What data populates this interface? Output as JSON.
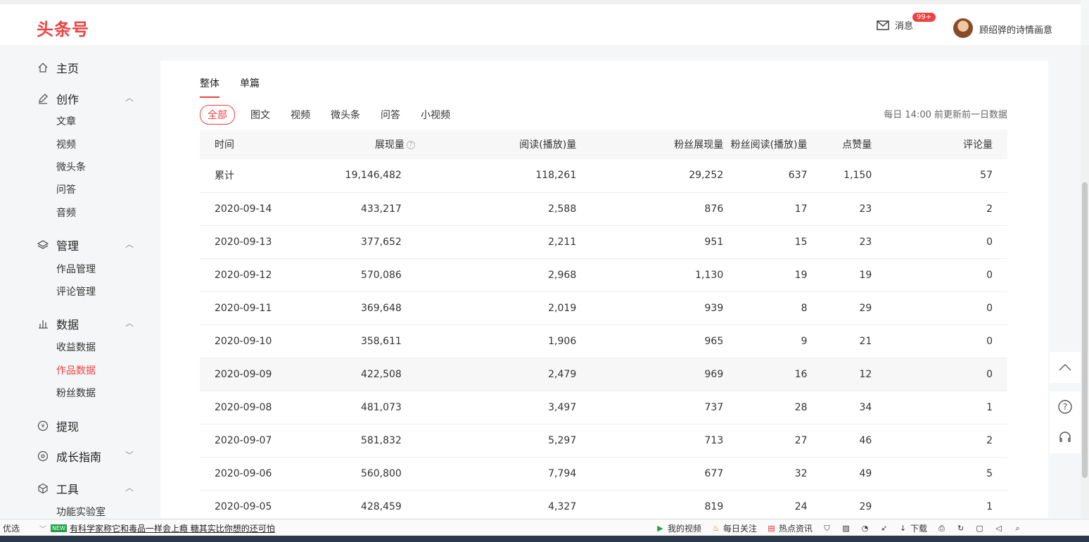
{
  "header": {
    "logo": "头条号",
    "messages_label": "消息",
    "messages_badge": "99+",
    "username": "顾绍骅的诗情画意"
  },
  "sidebar": {
    "groups": [
      {
        "label": "主页",
        "icon": "home-icon"
      },
      {
        "label": "创作",
        "icon": "pen-icon",
        "items": [
          "文章",
          "视频",
          "微头条",
          "问答",
          "音频"
        ]
      },
      {
        "label": "管理",
        "icon": "layers-icon",
        "items": [
          "作品管理",
          "评论管理"
        ]
      },
      {
        "label": "数据",
        "icon": "bar-chart-icon",
        "items": [
          "收益数据",
          "作品数据",
          "粉丝数据"
        ]
      },
      {
        "label": "提现",
        "icon": "coin-icon"
      },
      {
        "label": "成长指南",
        "icon": "compass-icon"
      },
      {
        "label": "工具",
        "icon": "cube-icon",
        "items": [
          "功能实验室"
        ]
      }
    ],
    "active_item": "作品数据"
  },
  "main": {
    "tabs_primary": [
      "整体",
      "单篇"
    ],
    "tabs_secondary": [
      "全部",
      "图文",
      "视频",
      "微头条",
      "问答",
      "小视频"
    ],
    "update_note": "每日 14:00 前更新前一日数据",
    "table": {
      "headers": [
        "时间",
        "展现量",
        "阅读(播放)量",
        "粉丝展现量",
        "粉丝阅读(播放)量",
        "点赞量",
        "评论量"
      ],
      "rows": [
        [
          "累计",
          "19,146,482",
          "118,261",
          "29,252",
          "637",
          "1,150",
          "57"
        ],
        [
          "2020-09-14",
          "433,217",
          "2,588",
          "876",
          "17",
          "23",
          "2"
        ],
        [
          "2020-09-13",
          "377,652",
          "2,211",
          "951",
          "15",
          "23",
          "0"
        ],
        [
          "2020-09-12",
          "570,086",
          "2,968",
          "1,130",
          "19",
          "19",
          "0"
        ],
        [
          "2020-09-11",
          "369,648",
          "2,019",
          "939",
          "8",
          "29",
          "0"
        ],
        [
          "2020-09-10",
          "358,611",
          "1,906",
          "965",
          "9",
          "21",
          "0"
        ],
        [
          "2020-09-09",
          "422,508",
          "2,479",
          "969",
          "16",
          "12",
          "0"
        ],
        [
          "2020-09-08",
          "481,073",
          "3,497",
          "737",
          "28",
          "34",
          "1"
        ],
        [
          "2020-09-07",
          "581,832",
          "5,297",
          "713",
          "27",
          "46",
          "2"
        ],
        [
          "2020-09-06",
          "560,800",
          "7,794",
          "677",
          "32",
          "49",
          "5"
        ],
        [
          "2020-09-05",
          "428,459",
          "4,327",
          "819",
          "24",
          "29",
          "1"
        ]
      ]
    }
  },
  "statusbar": {
    "left_label": "优选",
    "new_tag": "NEW",
    "news": "有科学家称它和毒品一样会上瘾 糖其实比你想的还可怕",
    "items": [
      "我的视频",
      "每日关注",
      "热点资讯",
      "下载"
    ]
  }
}
